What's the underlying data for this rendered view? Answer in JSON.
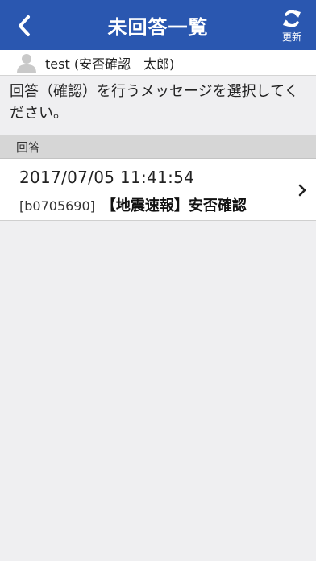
{
  "header": {
    "title": "未回答一覧",
    "back_icon": "chevron-left-icon",
    "refresh_icon": "refresh-icon",
    "refresh_label": "更新",
    "background_color": "#2a57b0"
  },
  "user": {
    "avatar_icon": "person-icon",
    "name": "test (安否確認　太郎)"
  },
  "instruction": "回答（確認）を行うメッセージを選択してください。",
  "section": {
    "label": "回答"
  },
  "messages": [
    {
      "datetime": "2017/07/05 11:41:54",
      "id": "[b0705690]",
      "subject": "【地震速報】安否確認",
      "chevron_icon": "chevron-right-icon"
    }
  ]
}
